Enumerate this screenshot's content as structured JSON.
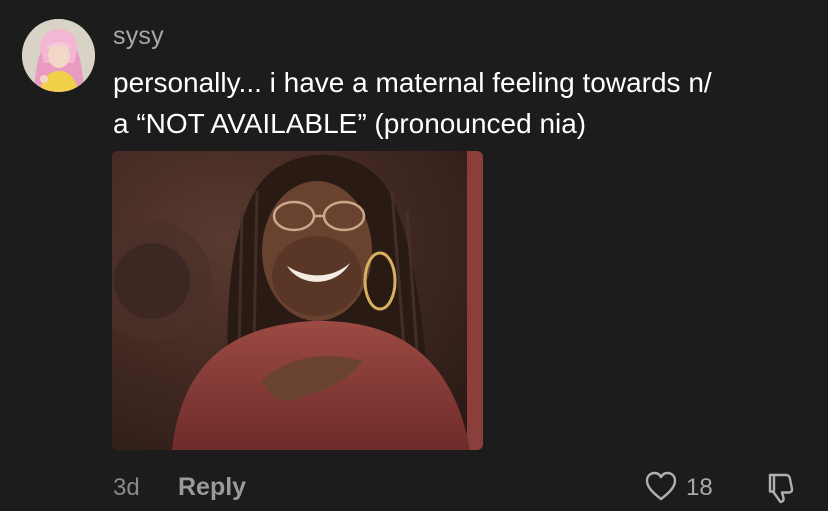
{
  "comment": {
    "username": "sysy",
    "text_line1": "personally... i have a maternal feeling towards n/",
    "text_line2": "a “NOT AVAILABLE” (pronounced nia)",
    "image_alt": "reaction image of a man with braids and hoop earring, hand on chest",
    "time": "3d",
    "reply_label": "Reply",
    "like_count": "18"
  },
  "icons": {
    "like": "heart-icon",
    "dislike": "thumbs-down-icon"
  },
  "colors": {
    "background": "#1c1c1c",
    "username": "#a8a8a8",
    "text": "#ffffff",
    "meta": "#8a8a8a"
  }
}
